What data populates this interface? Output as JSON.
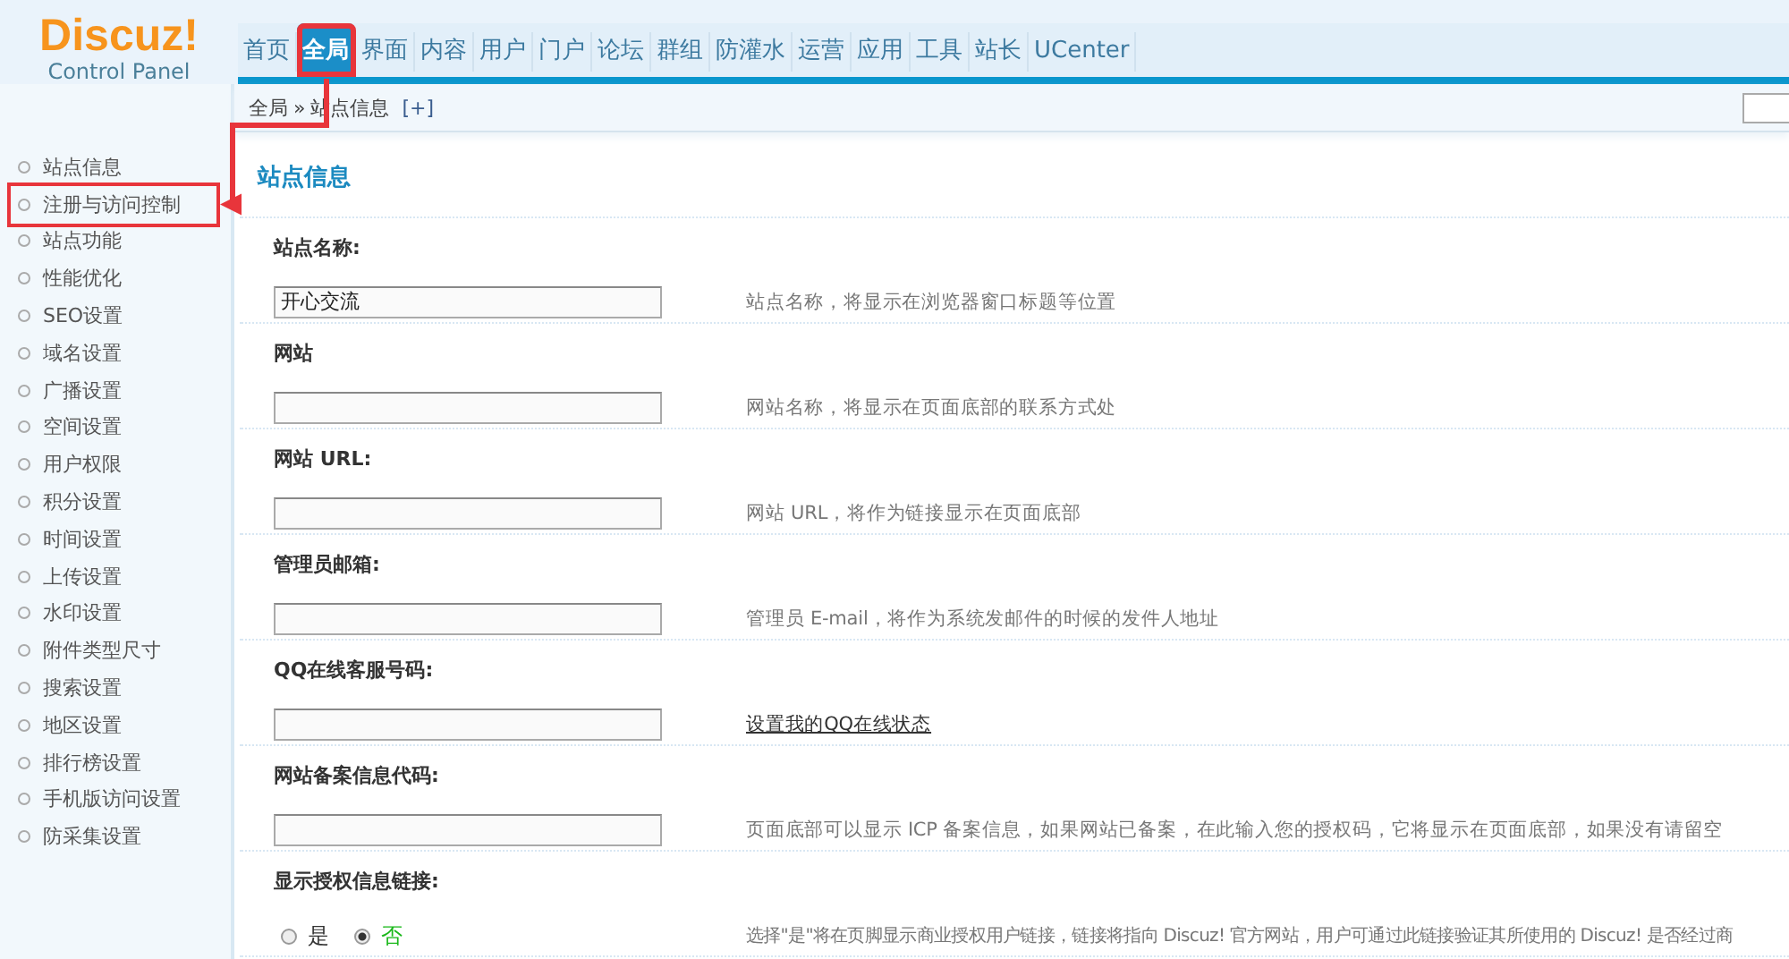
{
  "logo": {
    "title": "Discuz!",
    "subtitle": "Control Panel"
  },
  "nav": [
    {
      "label": "首页",
      "selected": false,
      "highlighted": false
    },
    {
      "label": "全局",
      "selected": true,
      "highlighted": true
    },
    {
      "label": "界面",
      "selected": false,
      "highlighted": false
    },
    {
      "label": "内容",
      "selected": false,
      "highlighted": false
    },
    {
      "label": "用户",
      "selected": false,
      "highlighted": false
    },
    {
      "label": "门户",
      "selected": false,
      "highlighted": false
    },
    {
      "label": "论坛",
      "selected": false,
      "highlighted": false
    },
    {
      "label": "群组",
      "selected": false,
      "highlighted": false
    },
    {
      "label": "防灌水",
      "selected": false,
      "highlighted": false
    },
    {
      "label": "运营",
      "selected": false,
      "highlighted": false
    },
    {
      "label": "应用",
      "selected": false,
      "highlighted": false
    },
    {
      "label": "工具",
      "selected": false,
      "highlighted": false
    },
    {
      "label": "站长",
      "selected": false,
      "highlighted": false
    },
    {
      "label": "UCenter",
      "selected": false,
      "highlighted": false
    }
  ],
  "breadcrumb": {
    "items": [
      "全局",
      "站点信息"
    ],
    "separator": "»",
    "add": "[+]",
    "search_box": true
  },
  "sidebar": {
    "items": [
      {
        "label": "站点信息",
        "highlighted": false
      },
      {
        "label": "注册与访问控制",
        "highlighted": true
      },
      {
        "label": "站点功能",
        "highlighted": false
      },
      {
        "label": "性能优化",
        "highlighted": false
      },
      {
        "label": "SEO设置",
        "highlighted": false
      },
      {
        "label": "域名设置",
        "highlighted": false
      },
      {
        "label": "广播设置",
        "highlighted": false
      },
      {
        "label": "空间设置",
        "highlighted": false
      },
      {
        "label": "用户权限",
        "highlighted": false
      },
      {
        "label": "积分设置",
        "highlighted": false
      },
      {
        "label": "时间设置",
        "highlighted": false
      },
      {
        "label": "上传设置",
        "highlighted": false
      },
      {
        "label": "水印设置",
        "highlighted": false
      },
      {
        "label": "附件类型尺寸",
        "highlighted": false
      },
      {
        "label": "搜索设置",
        "highlighted": false
      },
      {
        "label": "地区设置",
        "highlighted": false
      },
      {
        "label": "排行榜设置",
        "highlighted": false
      },
      {
        "label": "手机版访问设置",
        "highlighted": false
      },
      {
        "label": "防采集设置",
        "highlighted": false
      }
    ]
  },
  "section_title": "站点信息",
  "settings": [
    {
      "kind": "text",
      "label": "站点名称:",
      "value": "开心交流",
      "help": "站点名称，将显示在浏览器窗口标题等位置"
    },
    {
      "kind": "text",
      "label": "网站",
      "help": "网站名称，将显示在页面底部的联系方式处"
    },
    {
      "kind": "text",
      "label": "网站 URL:",
      "help": "网站 URL，将作为链接显示在页面底部"
    },
    {
      "kind": "text",
      "label": "管理员邮箱:",
      "help": "管理员 E-mail，将作为系统发邮件的时候的发件人地址"
    },
    {
      "kind": "text",
      "label": "QQ在线客服号码:",
      "help_link": "设置我的QQ在线状态"
    },
    {
      "kind": "text",
      "label": "网站备案信息代码:",
      "help": "页面底部可以显示 ICP 备案信息，如果网站已备案，在此输入您的授权码，它将显示在页面底部，如果没有请留空"
    },
    {
      "kind": "radio",
      "label": "显示授权信息链接:",
      "options": [
        {
          "label": "是",
          "selected": false
        },
        {
          "label": "否",
          "selected": true
        }
      ],
      "help": "选择\"是\"将在页脚显示商业授权用户链接，链接将指向 Discuz! 官方网站，用户可通过此链接验证其所使用的 Discuz! 是否经过商"
    }
  ]
}
